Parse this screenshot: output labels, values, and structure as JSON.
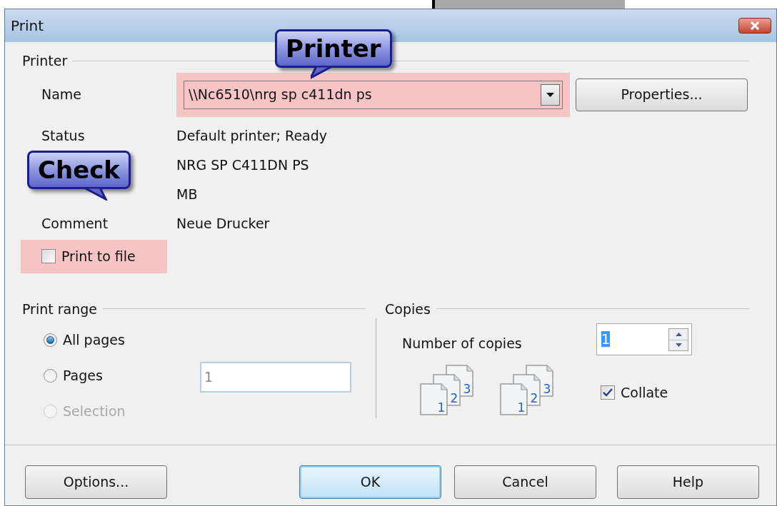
{
  "window": {
    "title": "Print"
  },
  "annotations": [
    {
      "text": "Printer"
    },
    {
      "text": "Check"
    }
  ],
  "printer": {
    "legend": "Printer",
    "fields": [
      {
        "label": "Name",
        "kind": "select",
        "value": "\\\\Nc6510\\nrg sp c411dn ps",
        "highlighted": true
      },
      {
        "label": "Status",
        "kind": "text",
        "value": "Default printer; Ready"
      },
      {
        "kind": "text",
        "value": "NRG SP C411DN PS"
      },
      {
        "kind": "text",
        "value": "MB"
      },
      {
        "label": "Comment",
        "kind": "text",
        "value": "Neue Drucker"
      }
    ],
    "properties_button": "Properties...",
    "print_to_file": {
      "label": "Print to file",
      "checked": false,
      "highlighted": true
    }
  },
  "print_range": {
    "legend": "Print range",
    "options": [
      {
        "label": "All pages",
        "selected": true,
        "disabled": false
      },
      {
        "label": "Pages",
        "selected": false,
        "disabled": false
      },
      {
        "label": "Selection",
        "selected": false,
        "disabled": true
      }
    ],
    "pages_field": {
      "value": "1",
      "disabled": true
    }
  },
  "copies": {
    "legend": "Copies",
    "label": "Number of copies",
    "value": "1",
    "collate_icons": [
      {
        "pages": [
          "1",
          "2",
          "3"
        ]
      },
      {
        "pages": [
          "1",
          "2",
          "3"
        ]
      }
    ],
    "collate": {
      "label": "Collate",
      "checked": true
    }
  },
  "buttons": [
    {
      "label": "Options...",
      "default": false
    },
    {
      "label": "OK",
      "default": true
    },
    {
      "label": "Cancel",
      "default": false
    },
    {
      "label": "Help",
      "default": false
    }
  ]
}
